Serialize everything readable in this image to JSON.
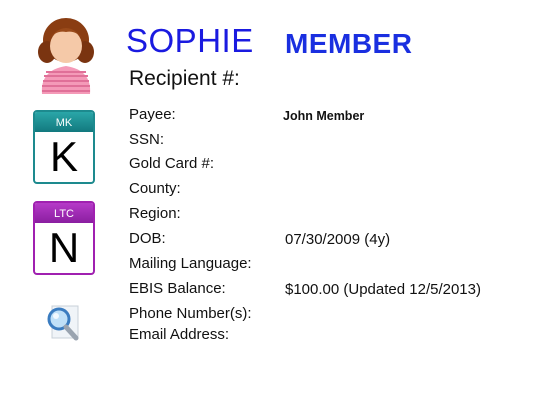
{
  "member": {
    "first_name": "SOPHIE",
    "last_name": "MEMBER",
    "recipient_label": "Recipient #:"
  },
  "badges": [
    {
      "code": "MK",
      "letter": "K",
      "color": "#1d8a8e"
    },
    {
      "code": "LTC",
      "letter": "N",
      "color": "#a020b0"
    }
  ],
  "fields": {
    "payee": {
      "label": "Payee:",
      "value": "John Member"
    },
    "ssn": {
      "label": "SSN:",
      "value": ""
    },
    "gold_card": {
      "label": "Gold Card #:",
      "value": ""
    },
    "county": {
      "label": "County:",
      "value": ""
    },
    "region": {
      "label": "Region:",
      "value": ""
    },
    "dob": {
      "label": "DOB:",
      "value": "07/30/2009  (4y)"
    },
    "mailing_language": {
      "label": "Mailing Language:",
      "value": ""
    },
    "ebis_balance": {
      "label": "EBIS Balance:",
      "value": "$100.00  (Updated 12/5/2013)"
    },
    "phone_numbers": {
      "label": "Phone Number(s):",
      "value": ""
    },
    "email_address": {
      "label": "Email Address:",
      "value": ""
    }
  },
  "icons": {
    "avatar": "female-person-icon",
    "search": "magnifier-icon"
  }
}
